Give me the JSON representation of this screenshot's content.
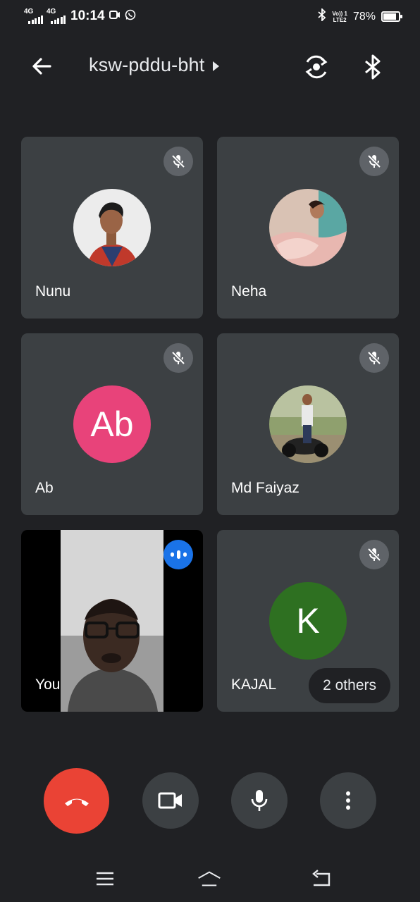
{
  "status_bar": {
    "network_1": "4G",
    "network_2": "4G",
    "time": "10:14",
    "volte_line1": "Vo)) 1",
    "volte_line2": "LTE2",
    "battery_percent": "78%",
    "battery_level": 0.78
  },
  "header": {
    "meeting_code": "ksw-pddu-bht"
  },
  "participants": [
    {
      "name": "Nunu",
      "avatar_type": "photo",
      "muted": true
    },
    {
      "name": "Neha",
      "avatar_type": "photo",
      "muted": true
    },
    {
      "name": "Ab",
      "initials": "Ab",
      "avatar_color": "#e8437a",
      "muted": true
    },
    {
      "name": "Md Faiyaz",
      "avatar_type": "photo",
      "muted": true
    },
    {
      "name": "You",
      "avatar_type": "video",
      "speaking": true
    },
    {
      "name": "KAJAL",
      "initials": "K",
      "avatar_color": "#2e7021",
      "muted": true
    }
  ],
  "others_chip": "2 others",
  "colors": {
    "background": "#202124",
    "tile": "#3c4043",
    "end_call": "#ea4335",
    "speaking": "#1a73e8"
  },
  "icons": {
    "back": "arrow-left-icon",
    "flip_camera": "flip-camera-icon",
    "bluetooth": "bluetooth-icon",
    "mute": "mic-off-icon",
    "end_call": "phone-hangup-icon",
    "camera": "videocam-icon",
    "mic": "mic-icon",
    "more": "more-vert-icon"
  }
}
